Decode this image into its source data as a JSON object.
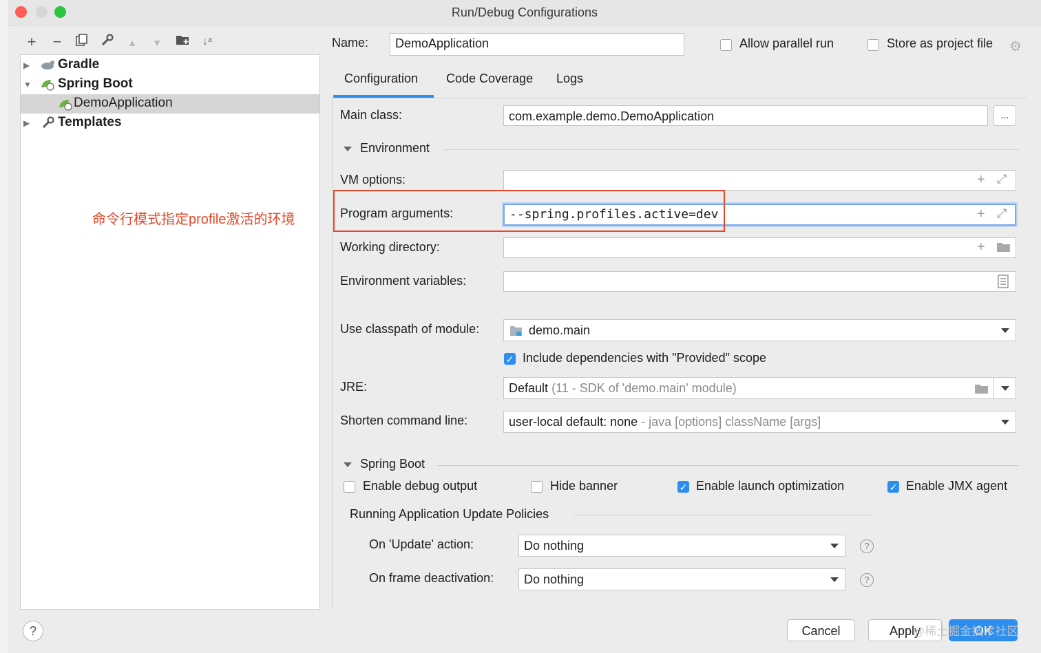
{
  "window": {
    "title": "Run/Debug Configurations"
  },
  "tree": {
    "items": [
      {
        "label": "Gradle"
      },
      {
        "label": "Spring Boot"
      },
      {
        "label": "DemoApplication"
      },
      {
        "label": "Templates"
      }
    ]
  },
  "annotation": "命令行模式指定profile激活的环境",
  "header": {
    "name_label": "Name:",
    "name_value": "DemoApplication",
    "parallel_label": "Allow parallel run",
    "store_label": "Store as project file"
  },
  "tabs": [
    "Configuration",
    "Code Coverage",
    "Logs"
  ],
  "config": {
    "main_class_label": "Main class:",
    "main_class_value": "com.example.demo.DemoApplication",
    "browse_label": "...",
    "environment_section": "Environment",
    "vm_options_label": "VM options:",
    "program_args_label": "Program arguments:",
    "program_args_value": "--spring.profiles.active=dev",
    "working_dir_label": "Working directory:",
    "env_vars_label": "Environment variables:",
    "classpath_label": "Use classpath of module:",
    "classpath_value": "demo.main",
    "include_deps_label": "Include dependencies with \"Provided\" scope",
    "jre_label": "JRE:",
    "jre_value": "Default",
    "jre_hint": "(11 - SDK of 'demo.main' module)",
    "shorten_label": "Shorten command line:",
    "shorten_value": "user-local default: none",
    "shorten_hint": "- java [options] className [args]"
  },
  "spring_boot": {
    "section": "Spring Boot",
    "debug_output": "Enable debug output",
    "hide_banner": "Hide banner",
    "launch_opt": "Enable launch optimization",
    "jmx_agent": "Enable JMX agent",
    "policies_title": "Running Application Update Policies",
    "on_update_label": "On 'Update' action:",
    "on_update_value": "Do nothing",
    "on_frame_label": "On frame deactivation:",
    "on_frame_value": "Do nothing"
  },
  "footer": {
    "cancel": "Cancel",
    "apply": "Apply",
    "ok": "OK",
    "watermark": "@稀土掘金技术社区"
  },
  "colors": {
    "accent": "#2d8ef0",
    "highlight_box": "#e6472a",
    "annotation": "#e6472a"
  }
}
